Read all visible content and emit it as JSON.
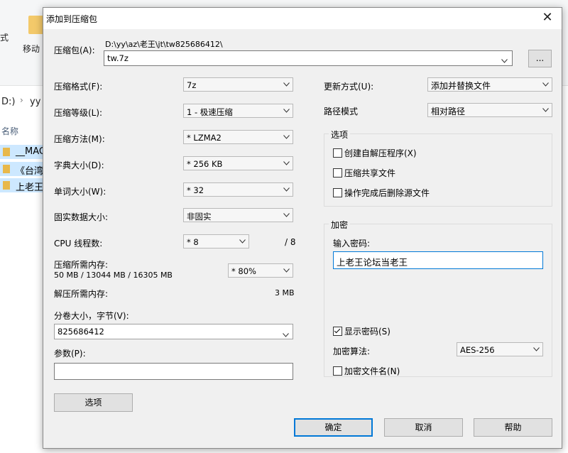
{
  "background": {
    "ribbon_label": "式",
    "move_label": "移动",
    "path_crumb": "D:)",
    "path_crumb2": "yy",
    "column_name": "名称",
    "rows": [
      "__MAC",
      "《台湾",
      "上老王"
    ]
  },
  "dialog": {
    "title": "添加到压缩包",
    "archive_label": "压缩包(A):",
    "archive_path": "D:\\yy\\az\\老王\\jt\\tw825686412\\",
    "archive_name": "tw.7z",
    "browse_label": "...",
    "format_label": "压缩格式(F):",
    "format_value": "7z",
    "level_label": "压缩等级(L):",
    "level_value": "1 - 极速压缩",
    "method_label": "压缩方法(M):",
    "method_value": "* LZMA2",
    "dict_label": "字典大小(D):",
    "dict_value": "* 256 KB",
    "word_label": "单词大小(W):",
    "word_value": "* 32",
    "solid_label": "固实数据大小:",
    "solid_value": "非固实",
    "cpu_label": "CPU 线程数:",
    "cpu_value": "* 8",
    "cpu_total": "/ 8",
    "mem_label": "压缩所需内存:",
    "mem_info": "50 MB / 13044 MB / 16305 MB",
    "mem_value": "* 80%",
    "decomp_label": "解压所需内存:",
    "decomp_value": "3 MB",
    "split_label": "分卷大小，字节(V):",
    "split_value": "825686412",
    "params_label": "参数(P):",
    "params_value": "",
    "options_button": "选项",
    "update_label": "更新方式(U):",
    "update_value": "添加并替换文件",
    "pathmode_label": "路径模式",
    "pathmode_value": "相对路径",
    "options_group": "选项",
    "opt_sfx": "创建自解压程序(X)",
    "opt_shared": "压缩共享文件",
    "opt_delete": "操作完成后删除源文件",
    "encrypt_group": "加密",
    "password_label": "输入密码:",
    "password_value": "上老王论坛当老王",
    "show_password": "显示密码(S)",
    "enc_method_label": "加密算法:",
    "enc_method_value": "AES-256",
    "enc_names": "加密文件名(N)",
    "ok": "确定",
    "cancel": "取消",
    "help": "帮助"
  }
}
